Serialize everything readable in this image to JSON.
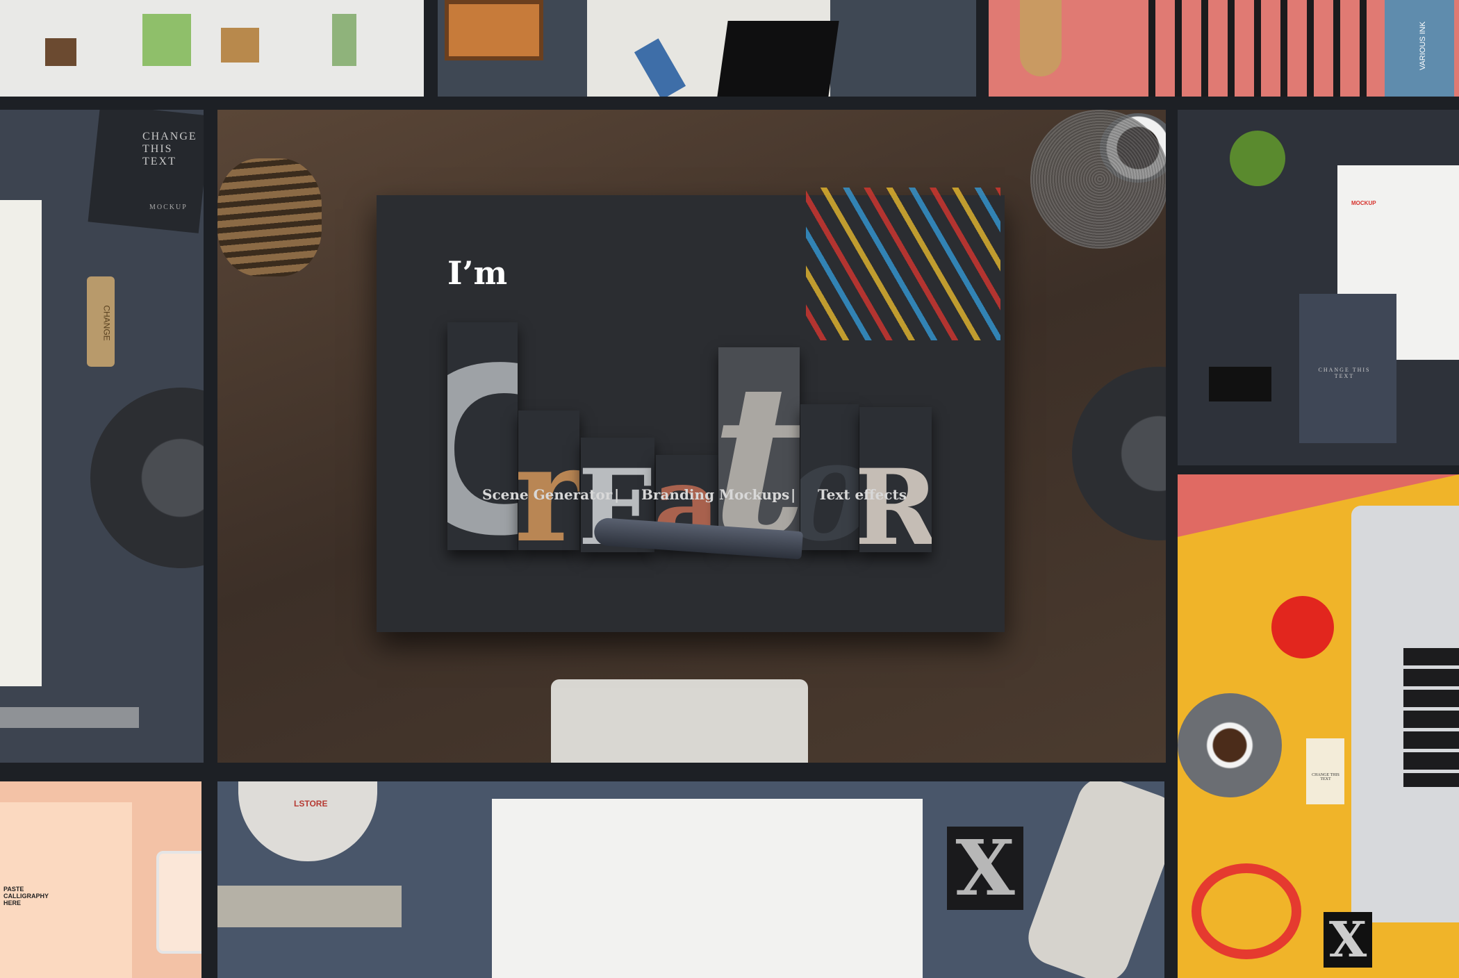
{
  "hero": {
    "prefix": "I’m",
    "letters": [
      "C",
      "r",
      "E",
      "a",
      "t",
      "o",
      "R"
    ],
    "features": [
      "Scene Generator",
      "Branding Mockups",
      "Text effects"
    ],
    "separator": "|"
  },
  "mockup_labels": {
    "left_card": "CHANGE THIS TEXT",
    "left_card_sub": "MOCKUP",
    "left_tag": "CHANGE",
    "paste": "PASTE CALLIGRAPHY HERE",
    "letterhead": "MOCKUP",
    "tag": "CHANGE THIS TEXT",
    "cap": "LSTORE",
    "tube": "VARIOUS INK",
    "block_x": "X"
  },
  "colors": {
    "gap": "#1d2025",
    "wood": "#4a3a30",
    "board": "#2b2d31",
    "yellow": "#f0b429",
    "coral": "#e06a63",
    "peach": "#f3c2a6"
  }
}
